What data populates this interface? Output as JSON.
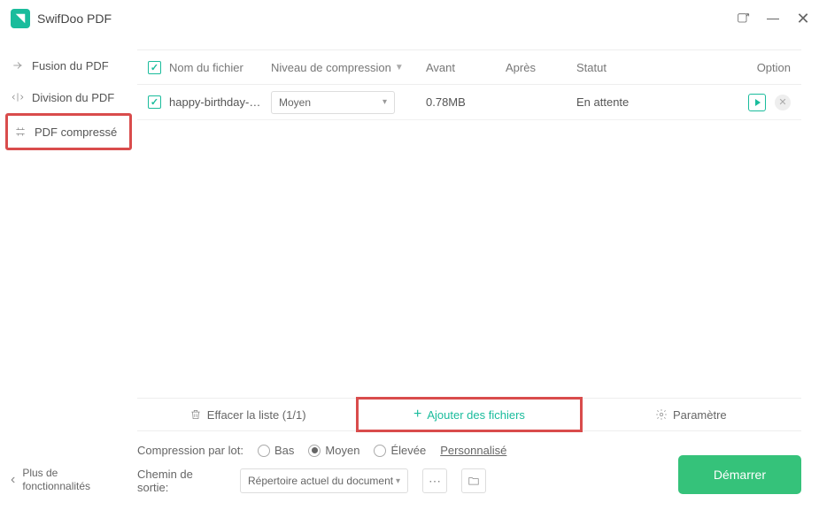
{
  "app": {
    "title": "SwifDoo PDF"
  },
  "sidebar": {
    "items": [
      {
        "label": "Fusion du PDF"
      },
      {
        "label": "Division du PDF"
      },
      {
        "label": "PDF compressé"
      }
    ],
    "more_line1": "Plus de",
    "more_line2": "fonctionnalités"
  },
  "table": {
    "headers": {
      "name": "Nom du fichier",
      "level": "Niveau de compression",
      "before": "Avant",
      "after": "Après",
      "status": "Statut",
      "option": "Option"
    },
    "rows": [
      {
        "name": "happy-birthday-c...",
        "level": "Moyen",
        "before": "0.78MB",
        "after": "",
        "status": "En attente"
      }
    ]
  },
  "actionbar": {
    "clear": "Effacer la liste (1/1)",
    "add": "Ajouter des fichiers",
    "settings": "Paramètre"
  },
  "bottom": {
    "batch_label": "Compression par lot:",
    "radio_low": "Bas",
    "radio_med": "Moyen",
    "radio_high": "Élevée",
    "custom": "Personnalisé",
    "path_label": "Chemin de sortie:",
    "path_value": "Répertoire actuel du document",
    "start": "Démarrer"
  }
}
